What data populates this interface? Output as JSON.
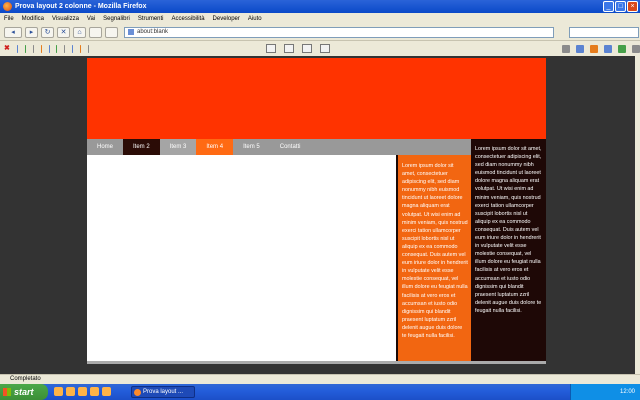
{
  "window": {
    "title": "Prova layout 2 colonne - Mozilla Firefox"
  },
  "menubar": {
    "items": [
      "File",
      "Modifica",
      "Visualizza",
      "Vai",
      "Segnalibri",
      "Strumenti",
      "Accessibilità",
      "Developer",
      "Aiuto"
    ]
  },
  "navbar": {
    "back": "◂",
    "forward": "▸",
    "reload": "↻",
    "stop": "✕",
    "home": "⌂",
    "url": "about:blank"
  },
  "page": {
    "nav_items": [
      "Home",
      "Item 2",
      "Item 3",
      "Item 4",
      "Item 5",
      "Contatti"
    ],
    "col_orange_text": "Lorem ipsum dolor sit amet, consectetuer adipiscing elit, sed diam nonummy nibh euismod tincidunt ut laoreet dolore magna aliquam erat volutpat. Ut wisi enim ad minim veniam, quis nostrud exerci tation ullamcorper suscipit lobortis nisl ut aliquip ex ea commodo consequat. Duis autem vel eum iriure dolor in hendrerit in vulputate velit esse molestie consequat, vel illum dolore eu feugiat nulla facilisis at vero eros et accumsan et iusto odio dignissim qui blandit praesent luptatum zzril delenit augue duis dolore te feugait nulla facilisi.",
    "col_dark_text": "Lorem ipsum dolor sit amet, consectetuer adipiscing elit, sed diam nonummy nibh euismod tincidunt ut laoreet dolore magna aliquam erat volutpat. Ut wisi enim ad minim veniam, quis nostrud exerci tation ullamcorper suscipit lobortis nisl ut aliquip ex ea commodo consequat. Duis autem vel eum iriure dolor in hendrerit in vulputate velit esse molestie consequat, vel illum dolore eu feugiat nulla facilisis at vero eros et accumsan et iusto odio dignissim qui blandit praesent luptatum zzril delenit augue duis dolore te feugait nulla facilisi."
  },
  "statusbar": {
    "text": "Completato"
  },
  "taskbar": {
    "start_label": "start",
    "task_label": "Prova layout ...",
    "clock": "12:00"
  },
  "colors": {
    "header": "#ff3300",
    "nav_active_dark": "#2b0c06",
    "nav_active_orange": "#ff6a13",
    "col_orange": "#f26611",
    "col_dark": "#1e0806"
  }
}
